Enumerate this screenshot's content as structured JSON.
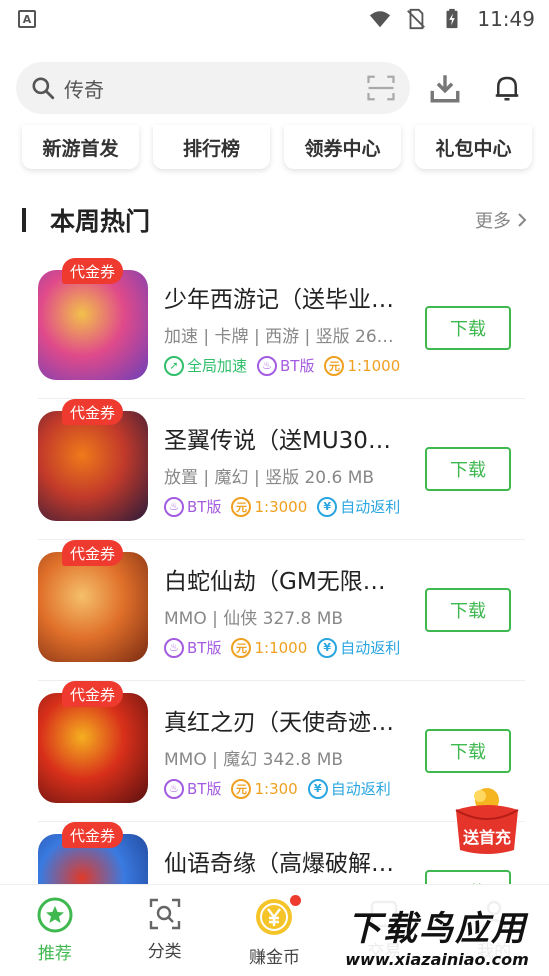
{
  "status_bar": {
    "time": "11:49"
  },
  "search": {
    "query": "传奇"
  },
  "quick_nav": [
    "新游首发",
    "排行榜",
    "领券中心",
    "礼包中心"
  ],
  "section": {
    "title": "本周热门",
    "more_label": "更多"
  },
  "games": [
    {
      "badge": "代金券",
      "name": "少年西游记（送毕业…",
      "meta": "加速 | 卡牌 | 西游 | 竖版 268....",
      "tags": [
        {
          "icon": "rocket-icon",
          "label": "全局加速",
          "color": "#2fbf6a"
        },
        {
          "icon": "flame-icon",
          "label": "BT版",
          "color": "#a35be0"
        },
        {
          "icon": "coin-icon",
          "label": "1:1000",
          "color": "#f0a020"
        }
      ],
      "button": "下载",
      "thumb_colors": [
        "#6d3fb8",
        "#e04a8a",
        "#f2c04a"
      ]
    },
    {
      "badge": "代金券",
      "name": "圣翼传说（送MU30…",
      "meta": "放置 | 魔幻 | 竖版 20.6 MB",
      "tags": [
        {
          "icon": "flame-icon",
          "label": "BT版",
          "color": "#a35be0"
        },
        {
          "icon": "coin-icon",
          "label": "1:3000",
          "color": "#f0a020"
        },
        {
          "icon": "yen-icon",
          "label": "自动返利",
          "color": "#2aa6e0"
        }
      ],
      "button": "下载",
      "thumb_colors": [
        "#2a1a3a",
        "#c23a2a",
        "#f07a1a"
      ]
    },
    {
      "badge": "代金券",
      "name": "白蛇仙劫（GM无限…",
      "meta": "MMO | 仙侠 327.8 MB",
      "tags": [
        {
          "icon": "flame-icon",
          "label": "BT版",
          "color": "#a35be0"
        },
        {
          "icon": "coin-icon",
          "label": "1:1000",
          "color": "#f0a020"
        },
        {
          "icon": "yen-icon",
          "label": "自动返利",
          "color": "#2aa6e0"
        }
      ],
      "button": "下载",
      "thumb_colors": [
        "#7a2a12",
        "#e0702a",
        "#f5c06a"
      ]
    },
    {
      "badge": "代金券",
      "name": "真红之刃（天使奇迹…",
      "meta": "MMO | 魔幻 342.8 MB",
      "tags": [
        {
          "icon": "flame-icon",
          "label": "BT版",
          "color": "#a35be0"
        },
        {
          "icon": "coin-icon",
          "label": "1:300",
          "color": "#f0a020"
        },
        {
          "icon": "yen-icon",
          "label": "自动返利",
          "color": "#2aa6e0"
        }
      ],
      "button": "下载",
      "thumb_colors": [
        "#5a1010",
        "#d8301a",
        "#f5b020"
      ]
    },
    {
      "badge": "代金券",
      "name": "仙语奇缘（高爆破解…",
      "meta": "",
      "tags": [],
      "button": "下载",
      "thumb_colors": [
        "#1a3a8a",
        "#3a7ae0",
        "#e03a2a"
      ]
    }
  ],
  "red_packet": {
    "label": "送首充"
  },
  "tabs": [
    {
      "label": "推荐",
      "icon": "star-icon",
      "active": true
    },
    {
      "label": "分类",
      "icon": "category-search-icon",
      "active": false
    },
    {
      "label": "赚金币",
      "icon": "yen-coin-icon",
      "active": false
    },
    {
      "label": "交易",
      "icon": "trade-icon",
      "active": false
    },
    {
      "label": "我的",
      "icon": "profile-icon",
      "active": false
    }
  ],
  "watermark": {
    "line1": "下载鸟应用",
    "line2": "www.xiazainiao.com"
  }
}
